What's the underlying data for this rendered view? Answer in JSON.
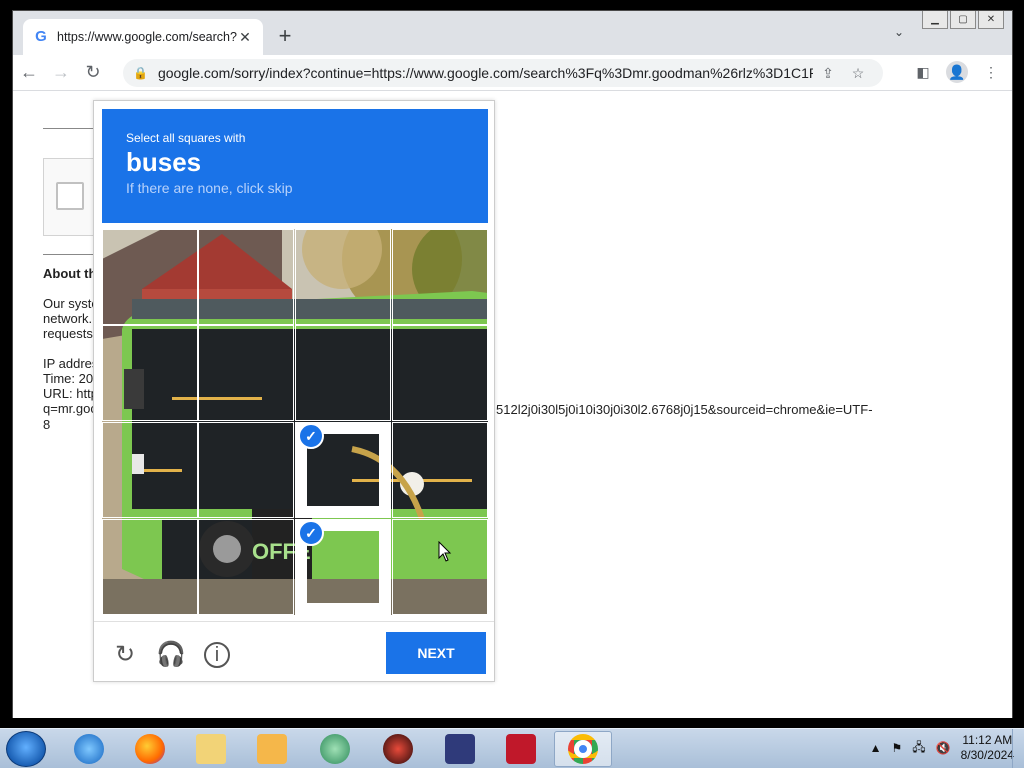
{
  "browser": {
    "tab_title": "https://www.google.com/search?",
    "tab_favicon": "G",
    "tab_close": "✕",
    "new_tab": "+",
    "tab_menu": "⌄",
    "url": "google.com/sorry/index?continue=https://www.google.com/search%3Fq%3Dmr.goodman%26rlz%3D1C1P..."
  },
  "page": {
    "about_heading": "About th",
    "para": "Our syste network. requests",
    "ip_label": "IP addres",
    "time_label": "Time: 20",
    "url_label": "URL: http",
    "url_q": "q=mr.goo",
    "url_tail": "512l2j0i30l5j0i10i30j0i30l2.6768j0j15&sourceid=chrome&ie=UTF-",
    "url_last": "8"
  },
  "captcha": {
    "instruction": "Select all squares with",
    "target": "buses",
    "subtext": "If there are none, click skip",
    "next_label": "NEXT",
    "selected_cells": [
      10,
      14
    ]
  },
  "taskbar": {
    "apps": [
      "internet-explorer",
      "firefox",
      "file-explorer",
      "media-player",
      "app-green",
      "app-red",
      "app-photo",
      "app-recorder",
      "chrome"
    ],
    "time": "11:12 AM",
    "date": "8/30/2024"
  },
  "colors": {
    "accent": "#1a73e8",
    "bus_green": "#7dc750"
  }
}
